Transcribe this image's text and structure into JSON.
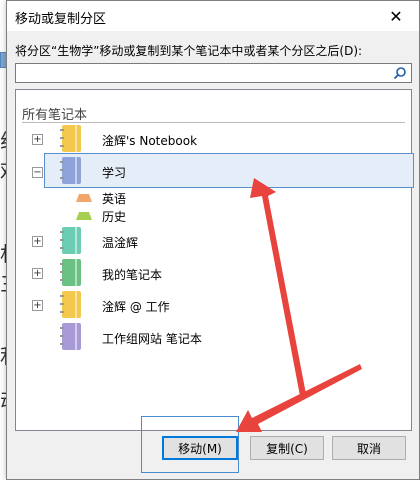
{
  "dialog": {
    "title": "移动或复制分区",
    "close_glyph": "✕",
    "prompt": "将分区“生物学”移动或复制到某个笔记本中或者某个分区之后(D):",
    "search": {
      "value": "",
      "placeholder": ""
    }
  },
  "tree": {
    "header": "所有笔记本",
    "notebooks": [
      {
        "label": "淦辉's Notebook",
        "color": "#f3c84d",
        "expander": "+"
      },
      {
        "label": "学习",
        "color": "#8da3da",
        "expander": "−"
      },
      {
        "label": "温淦辉",
        "color": "#6ccdb5",
        "expander": "+"
      },
      {
        "label": "我的笔记本",
        "color": "#69c184",
        "expander": "+"
      },
      {
        "label": "淦辉 @ 工作",
        "color": "#f3c84d",
        "expander": "+"
      },
      {
        "label": "工作组网站 笔记本",
        "color": "#a79ad6",
        "expander": ""
      }
    ],
    "sections": [
      {
        "label": "英语",
        "color": "#f3a66a"
      },
      {
        "label": "历史",
        "color": "#a6cf52"
      }
    ]
  },
  "buttons": {
    "move": "移动(M)",
    "copy": "复制(C)",
    "cancel": "取消"
  },
  "background_glyphs": [
    "组",
    "欢",
    "林",
    "三",
    "利",
    "动"
  ]
}
